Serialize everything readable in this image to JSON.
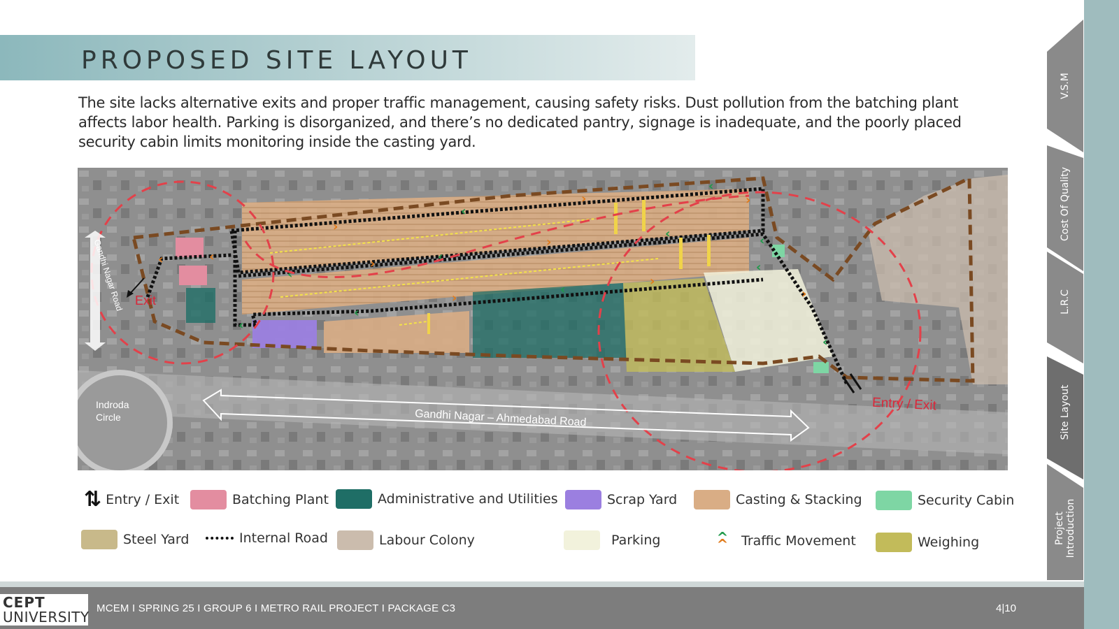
{
  "slide": {
    "title": "PROPOSED SITE LAYOUT",
    "description": "The site lacks alternative exits and proper traffic management, causing safety risks. Dust pollution from the batching plant affects labor health. Parking is disorganized, and there’s no dedicated pantry, signage is inadequate, and the poorly placed security cabin limits monitoring inside the casting yard."
  },
  "map": {
    "label_exit": "Exit",
    "label_entry_exit": "Entry / Exit",
    "label_road_vertical": "Gandhi Nagar Road",
    "label_road_main": "Gandhi Nagar – Ahmedabad Road",
    "label_circle_1": "Indroda",
    "label_circle_2": "Circle"
  },
  "legend": {
    "entry_exit": "Entry / Exit",
    "batching_plant": "Batching Plant",
    "admin_utilities": "Administrative and Utilities",
    "scrap_yard": "Scrap Yard",
    "casting_stacking": "Casting & Stacking",
    "security_cabin": "Security Cabin",
    "steel_yard": "Steel Yard",
    "internal_road": "Internal Road",
    "labour_colony": "Labour Colony",
    "parking": "Parking",
    "traffic_movement": "Traffic Movement",
    "weighing": "Weighing"
  },
  "colors": {
    "batching_plant": "#e38da0",
    "admin_utilities": "#1f6e66",
    "scrap_yard": "#9b7fe0",
    "casting_stacking": "#d9ad85",
    "security_cabin": "#7ed6a4",
    "steel_yard": "#c8b98a",
    "labour_colony": "#cbbcad",
    "parking": "#f2f2dc",
    "weighing": "#c2bb5a"
  },
  "footer": {
    "logo_line1": "CEPT",
    "logo_line2": "UNIVERSITY",
    "course": "MCEM I SPRING 25 I GROUP 6 I METRO RAIL PROJECT I PACKAGE C3",
    "page": "4|10"
  },
  "tabs": [
    {
      "label": "V.S.M"
    },
    {
      "label": "Cost Of Quality"
    },
    {
      "label": "L.R.C"
    },
    {
      "label": "Site Layout"
    },
    {
      "label": "Project Introduction"
    }
  ]
}
